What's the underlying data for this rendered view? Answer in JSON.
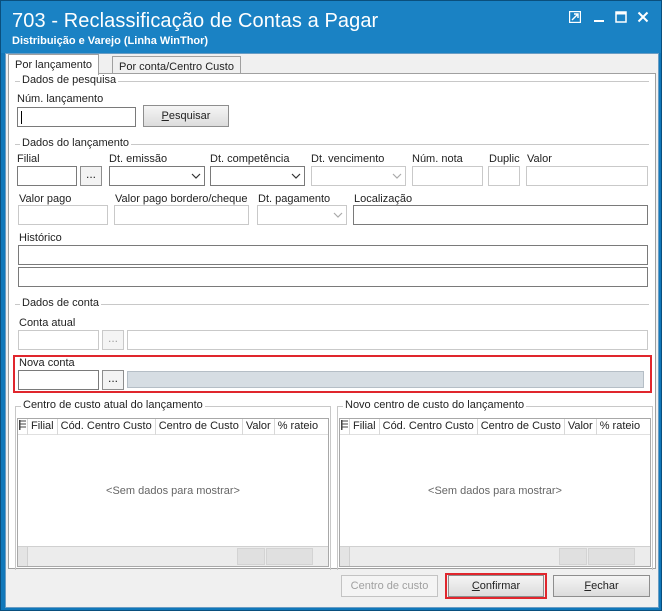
{
  "window": {
    "title": "703 - Reclassificação de Contas a Pagar",
    "subtitle": "Distribuição e Varejo (Linha WinThor)",
    "controls": [
      "restore-icon",
      "minimize-icon",
      "maximize-icon",
      "close-icon"
    ]
  },
  "tabs": [
    {
      "label": "Por lançamento",
      "active": true
    },
    {
      "label": "Por conta/Centro Custo",
      "active": false
    }
  ],
  "search": {
    "group_title": "Dados de pesquisa",
    "num_label": "Núm. lançamento",
    "num_value": "",
    "button_label": "Pesquisar",
    "button_underline": "P",
    "button_rest": "esquisar"
  },
  "lancamento": {
    "group_title": "Dados do lançamento",
    "filial_label": "Filial",
    "dt_emissao_label": "Dt. emissão",
    "dt_competencia_label": "Dt. competência",
    "dt_vencimento_label": "Dt. vencimento",
    "num_nota_label": "Núm. nota",
    "duplic_label": "Duplic",
    "valor_label": "Valor",
    "valor_pago_label": "Valor pago",
    "valor_pago_bordero_label": "Valor pago bordero/cheque",
    "dt_pagamento_label": "Dt. pagamento",
    "localizacao_label": "Localização",
    "historico_label": "Histórico",
    "ellipsis": "..."
  },
  "conta": {
    "group_title": "Dados de conta",
    "conta_atual_label": "Conta atual",
    "nova_conta_label": "Nova conta",
    "ellipsis": "..."
  },
  "cc_atual": {
    "group_title": "Centro de custo atual do lançamento",
    "columns": [
      "Filial",
      "Cód. Centro Custo",
      "Centro de Custo",
      "Valor",
      "% rateio"
    ],
    "empty_text": "<Sem dados para mostrar>"
  },
  "cc_novo": {
    "group_title": "Novo centro de custo do lançamento",
    "columns": [
      "Filial",
      "Cód. Centro Custo",
      "Centro de Custo",
      "Valor",
      "% rateio"
    ],
    "empty_text": "<Sem dados para mostrar>"
  },
  "buttons": {
    "centro_custo": "Centro de custo",
    "confirmar_underline": "C",
    "confirmar_rest": "onfirmar",
    "fechar_underline": "F",
    "fechar_rest": "echar"
  },
  "colors": {
    "titlebar": "#1a82c4",
    "highlight": "#e0262d"
  }
}
